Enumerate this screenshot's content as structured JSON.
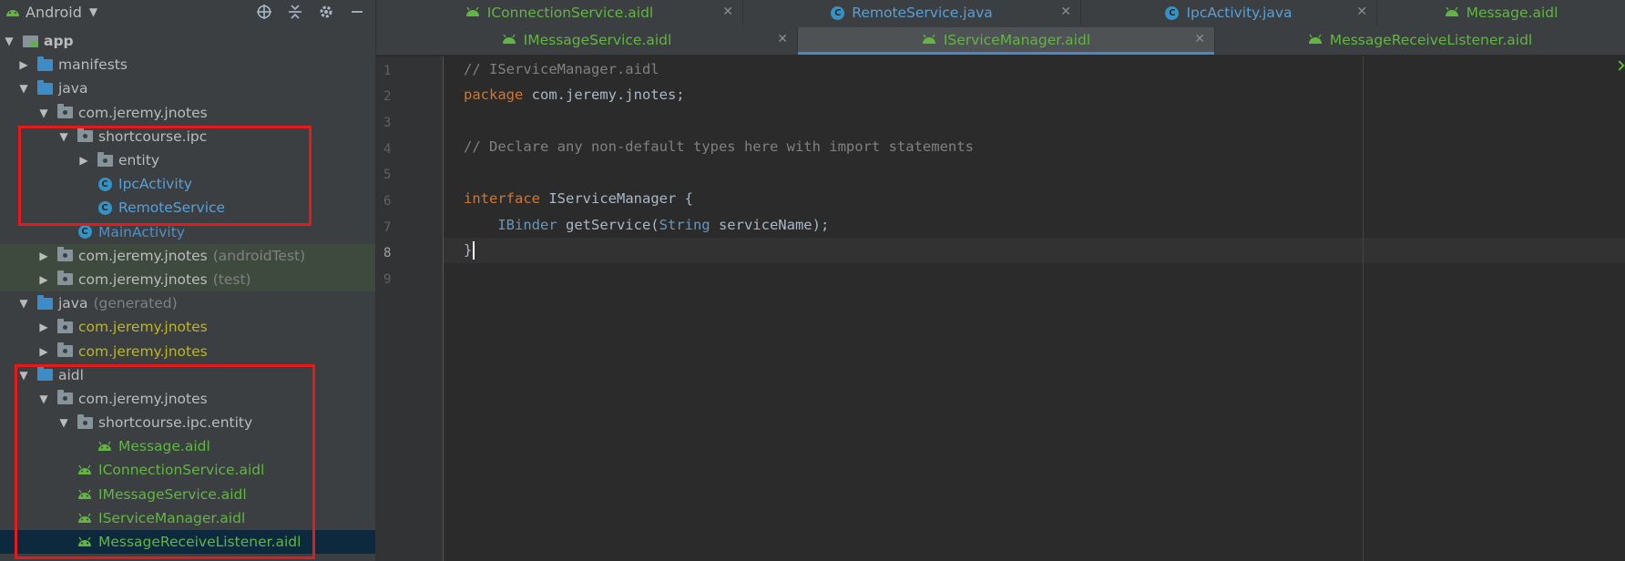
{
  "panel": {
    "view_label": "Android",
    "tree": [
      {
        "label": "app",
        "suffix": "",
        "icon": "module-icon",
        "expanded": true
      },
      {
        "label": "manifests",
        "suffix": "",
        "icon": "folder-icon",
        "expanded": false
      },
      {
        "label": "java",
        "suffix": "",
        "icon": "folder-icon",
        "expanded": true
      },
      {
        "label": "com.jeremy.jnotes",
        "suffix": "",
        "icon": "package-icon",
        "expanded": true
      },
      {
        "label": "shortcourse.ipc",
        "suffix": "",
        "icon": "package-icon",
        "expanded": true
      },
      {
        "label": "entity",
        "suffix": "",
        "icon": "package-icon",
        "expanded": false
      },
      {
        "label": "IpcActivity",
        "suffix": "",
        "icon": "class-icon"
      },
      {
        "label": "RemoteService",
        "suffix": "",
        "icon": "class-icon"
      },
      {
        "label": "MainActivity",
        "suffix": "",
        "icon": "class-icon"
      },
      {
        "label": "com.jeremy.jnotes",
        "suffix": "(androidTest)",
        "icon": "package-icon",
        "expanded": false
      },
      {
        "label": "com.jeremy.jnotes",
        "suffix": "(test)",
        "icon": "package-icon",
        "expanded": false
      },
      {
        "label": "java",
        "suffix": "(generated)",
        "icon": "folder-icon",
        "expanded": true
      },
      {
        "label": "com.jeremy.jnotes",
        "suffix": "",
        "icon": "package-icon",
        "expanded": false
      },
      {
        "label": "com.jeremy.jnotes",
        "suffix": "",
        "icon": "package-icon",
        "expanded": false
      },
      {
        "label": "aidl",
        "suffix": "",
        "icon": "folder-icon",
        "expanded": true
      },
      {
        "label": "com.jeremy.jnotes",
        "suffix": "",
        "icon": "package-icon",
        "expanded": true
      },
      {
        "label": "shortcourse.ipc.entity",
        "suffix": "",
        "icon": "package-icon",
        "expanded": true
      },
      {
        "label": "Message.aidl",
        "suffix": "",
        "icon": "android-icon"
      },
      {
        "label": "IConnectionService.aidl",
        "suffix": "",
        "icon": "android-icon"
      },
      {
        "label": "IMessageService.aidl",
        "suffix": "",
        "icon": "android-icon"
      },
      {
        "label": "IServiceManager.aidl",
        "suffix": "",
        "icon": "android-icon"
      },
      {
        "label": "MessageReceiveListener.aidl",
        "suffix": "",
        "icon": "android-icon"
      }
    ]
  },
  "tabs": {
    "row1": [
      {
        "label": "IConnectionService.aidl",
        "icon": "android-icon"
      },
      {
        "label": "RemoteService.java",
        "icon": "class-icon"
      },
      {
        "label": "IpcActivity.java",
        "icon": "class-icon"
      },
      {
        "label": "Message.aidl",
        "icon": "android-icon"
      }
    ],
    "row2": [
      {
        "label": "IMessageService.aidl",
        "icon": "android-icon"
      },
      {
        "label": "IServiceManager.aidl",
        "icon": "android-icon",
        "active": true
      },
      {
        "label": "MessageReceiveListener.aidl",
        "icon": "android-icon"
      }
    ]
  },
  "editor": {
    "line_numbers": [
      "1",
      "2",
      "3",
      "4",
      "5",
      "6",
      "7",
      "8",
      "9"
    ],
    "current_line": "8",
    "lines": {
      "l1": "// IServiceManager.aidl",
      "l2_kw": "package",
      "l2_rest": " com.jeremy.jnotes;",
      "l4": "// Declare any non-default types here with import statements",
      "l6_kw": "interface",
      "l6_rest": " IServiceManager {",
      "l7_indent": "    ",
      "l7_type": "IBinder",
      "l7_mid": " getService(",
      "l7_type2": "String",
      "l7_end": " serviceName);",
      "l8": "}"
    }
  },
  "colors": {
    "panel_bg": "#3c3f41",
    "editor_bg": "#2b2b2b",
    "highlight_box": "#e51b1b",
    "aidl_green": "#62b543",
    "class_blue": "#5a9fd4",
    "keyword_orange": "#cc7832",
    "comment_gray": "#808080"
  }
}
